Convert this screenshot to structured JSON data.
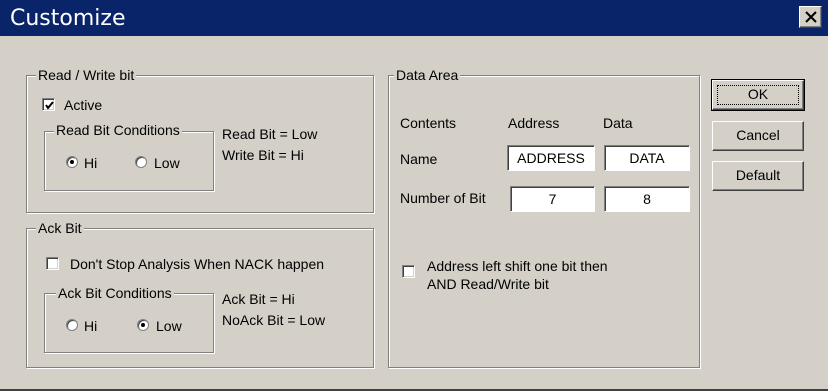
{
  "window": {
    "title": "Customize",
    "close_icon": "close-icon"
  },
  "read_write": {
    "legend": "Read / Write bit",
    "active_label": "Active",
    "active_checked": true,
    "conditions_legend": "Read Bit Conditions",
    "hi_label": "Hi",
    "low_label": "Low",
    "selected": "Hi",
    "info_line1": "Read Bit = Low",
    "info_line2": "Write Bit = Hi"
  },
  "ack": {
    "legend": "Ack Bit",
    "dont_stop_label": "Don't Stop Analysis When NACK happen",
    "dont_stop_checked": false,
    "conditions_legend": "Ack Bit Conditions",
    "hi_label": "Hi",
    "low_label": "Low",
    "selected": "Low",
    "info_line1": "Ack Bit = Hi",
    "info_line2": "NoAck Bit = Low"
  },
  "data_area": {
    "legend": "Data Area",
    "col_contents": "Contents",
    "col_address": "Address",
    "col_data": "Data",
    "row_name_label": "Name",
    "name_address": "ADDRESS",
    "name_data": "DATA",
    "row_bits_label": "Number of Bit",
    "bits_address": "7",
    "bits_data": "8",
    "shift_label_line1": "Address left shift one bit then",
    "shift_label_line2": "AND Read/Write bit",
    "shift_checked": false
  },
  "buttons": {
    "ok": "OK",
    "cancel": "Cancel",
    "default": "Default"
  },
  "colors": {
    "titlebar": "#0a246a",
    "face": "#d4d0c8"
  }
}
